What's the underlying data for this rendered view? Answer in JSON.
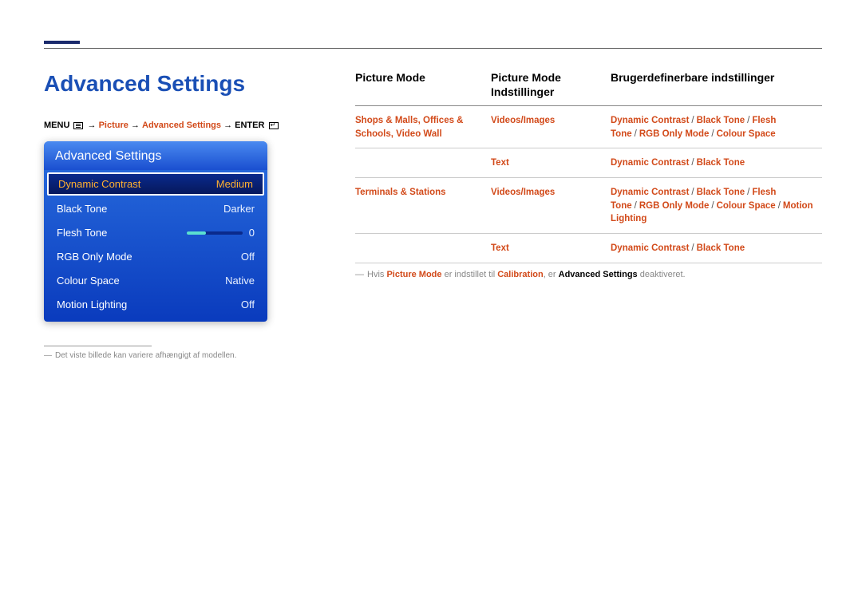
{
  "page_title": "Advanced Settings",
  "breadcrumb": {
    "menu": "MENU",
    "arrow": "→",
    "picture": "Picture",
    "adv": "Advanced Settings",
    "enter": "ENTER"
  },
  "osd": {
    "header": "Advanced Settings",
    "rows": [
      {
        "label": "Dynamic Contrast",
        "value": "Medium",
        "selected": true
      },
      {
        "label": "Black Tone",
        "value": "Darker"
      },
      {
        "label": "Flesh Tone",
        "value": "0",
        "slider": true
      },
      {
        "label": "RGB Only Mode",
        "value": "Off"
      },
      {
        "label": "Colour Space",
        "value": "Native"
      },
      {
        "label": "Motion Lighting",
        "value": "Off"
      }
    ]
  },
  "footnote_left": "Det viste billede kan variere afhængigt af modellen.",
  "table": {
    "headers": {
      "a": "Picture Mode",
      "b": "Picture Mode Indstillinger",
      "c": "Brugerdefinerbare indstillinger"
    },
    "rows": [
      {
        "a_items": [
          "Shops & Malls",
          "Offices & Schools",
          "Video Wall"
        ],
        "a_sep": ", ",
        "sub": [
          {
            "b": "Videos/Images",
            "c": [
              "Dynamic Contrast",
              "Black Tone",
              "Flesh Tone",
              "RGB Only Mode",
              "Colour Space"
            ]
          },
          {
            "b": "Text",
            "c": [
              "Dynamic Contrast",
              "Black Tone"
            ]
          }
        ]
      },
      {
        "a_items": [
          "Terminals & Stations"
        ],
        "a_sep": "",
        "sub": [
          {
            "b": "Videos/Images",
            "c": [
              "Dynamic Contrast",
              "Black Tone",
              "Flesh Tone",
              "RGB Only Mode",
              "Colour Space",
              "Motion Lighting"
            ]
          },
          {
            "b": "Text",
            "c": [
              "Dynamic Contrast",
              "Black Tone"
            ]
          }
        ]
      }
    ]
  },
  "note_right": {
    "pre": "Hvis ",
    "k1": "Picture Mode",
    "mid1": " er indstillet til ",
    "k2": "Calibration",
    "mid2": ", er ",
    "k3": "Advanced Settings",
    "post": " deaktiveret."
  }
}
